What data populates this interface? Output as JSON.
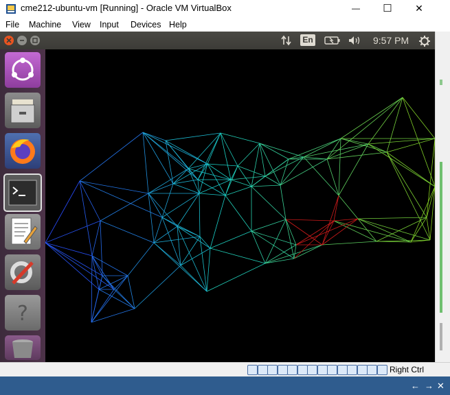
{
  "window": {
    "title": "cme212-ubuntu-vm [Running] - Oracle VM VirtualBox",
    "minimize_glyph": "—",
    "maximize_glyph": "☐",
    "close_glyph": "✕"
  },
  "menu": {
    "items": [
      "File",
      "Machine",
      "View",
      "Input",
      "Devices",
      "Help"
    ]
  },
  "ubuntu_panel": {
    "keyboard_layout": "En",
    "clock": "9:57 PM"
  },
  "launcher": {
    "items": [
      {
        "name": "ubuntu-dash-icon"
      },
      {
        "name": "files-icon"
      },
      {
        "name": "firefox-icon"
      },
      {
        "name": "terminal-icon"
      },
      {
        "name": "text-editor-icon"
      },
      {
        "name": "system-settings-icon"
      },
      {
        "name": "help-icon"
      },
      {
        "name": "trash-icon"
      }
    ]
  },
  "statusbar": {
    "host_key": "Right Ctrl",
    "icon_count": 14
  },
  "taskstrip": {
    "arrow_glyph": "←",
    "pin_glyph": "→",
    "close_glyph": "✕"
  },
  "colors": {
    "mesh_start": "#2a3cff",
    "mesh_mid": "#19d1c8",
    "mesh_end": "#8bd11b",
    "mesh_hot": "#d11b1b"
  }
}
